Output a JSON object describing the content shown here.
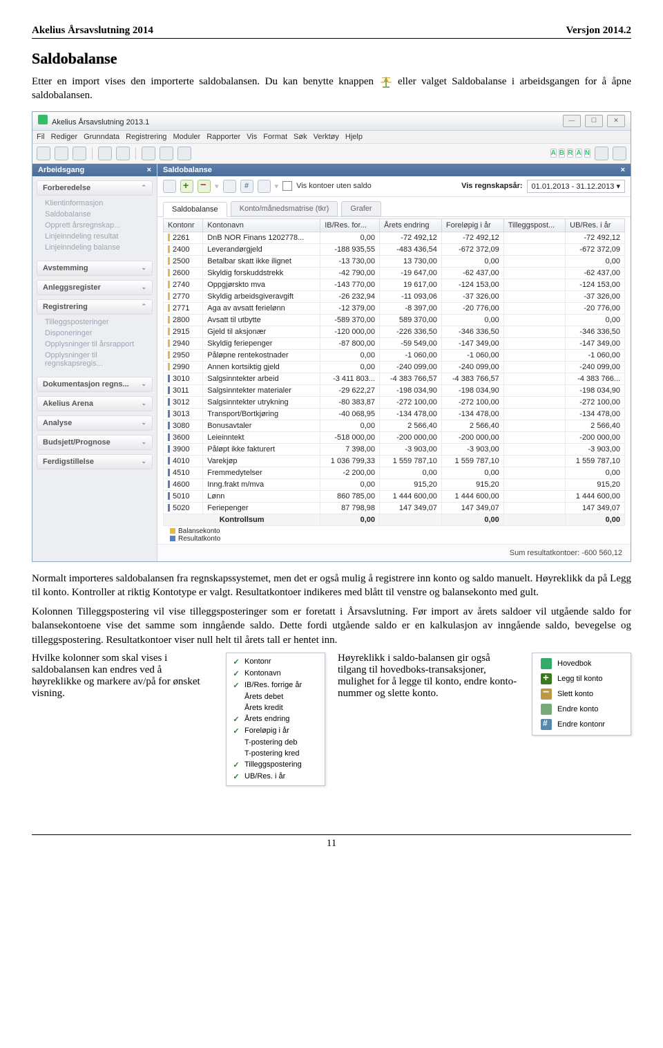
{
  "doc": {
    "header_left": "Akelius Årsavslutning 2014",
    "header_right": "Versjon 2014.2",
    "title": "Saldobalanse",
    "p1_a": "Etter en import vises den importerte saldobalansen. Du kan benytte knappen ",
    "p1_b": " eller valget Saldobalanse i arbeidsgangen for å åpne saldobalansen.",
    "p2": "Normalt importeres saldobalansen fra regnskapssystemet, men det er også mulig å registrere inn konto og saldo manuelt. Høyreklikk da på Legg til konto. Kontroller at riktig Kontotype er valgt. Resultatkontoer indikeres med blått til venstre og balansekonto med gult.",
    "p3": "Kolonnen Tilleggspostering vil vise tilleggsposteringer som er foretatt i Årsavslutning. Før import av årets saldoer vil utgående saldo for balansekontoene vise det samme som inngående saldo. Dette fordi utgående saldo er en kalkulasjon av inngående saldo, bevegelse og tilleggspostering. Resultatkontoer viser null helt til årets tall er hentet inn.",
    "left_col": "Hvilke kolonner som skal vises i saldobalansen kan endres ved å høyreklikke og markere av/på for ønsket visning.",
    "right_col": "Høyreklikk i saldo-balansen gir også tilgang til hovedboks-transaksjoner, mulighet for å legge til konto, endre konto-nummer og slette konto.",
    "page_number": "11"
  },
  "app": {
    "title": "Akelius Årsavslutning 2013.1",
    "menu": [
      "Fil",
      "Rediger",
      "Grunndata",
      "Registrering",
      "Moduler",
      "Rapporter",
      "Vis",
      "Format",
      "Søk",
      "Verktøy",
      "Hjelp"
    ],
    "sidebar_title": "Arbeidsgang",
    "groups": {
      "g1": "Forberedelse",
      "g1_items": [
        "Klientinformasjon",
        "Saldobalanse",
        "Opprett årsregnskap...",
        "Linjeinndeling resultat",
        "Linjeinndeling balanse"
      ],
      "g2": "Avstemming",
      "g3": "Anleggsregister",
      "g4": "Registrering",
      "g4_items": [
        "Tilleggsposteringer",
        "Disponeringer",
        "Opplysninger til årsrapport",
        "Opplysninger til regnskapsregis..."
      ],
      "g5": "Dokumentasjon regns...",
      "g6": "Akelius Arena",
      "g7": "Analyse",
      "g8": "Budsjett/Prognose",
      "g9": "Ferdigstillelse"
    },
    "content_title": "Saldobalanse",
    "show_no_saldo": "Vis kontoer uten saldo",
    "year_label": "Vis regnskapsår:",
    "year_value": "01.01.2013 - 31.12.2013",
    "tabs": [
      "Saldobalanse",
      "Konto/månedsmatrise (tkr)",
      "Grafer"
    ],
    "columns": [
      "Kontonr",
      "Kontonavn",
      "IB/Res. for...",
      "Årets endring",
      "Foreløpig i år",
      "Tilleggspost...",
      "UB/Res. i år"
    ],
    "legend_b": "Balansekonto",
    "legend_r": "Resultatkonto",
    "kontrollsum": "Kontrollsum",
    "ks_zero": "0,00",
    "sumline": "Sum resultatkontoer: -600 560,12"
  },
  "rows": [
    {
      "m": "y",
      "nr": "2261",
      "navn": "DnB NOR Finans 1202778...",
      "ib": "0,00",
      "end": "-72 492,12",
      "for": "-72 492,12",
      "til": "",
      "ub": "-72 492,12"
    },
    {
      "m": "y",
      "nr": "2400",
      "navn": "Leverandørgjeld",
      "ib": "-188 935,55",
      "end": "-483 436,54",
      "for": "-672 372,09",
      "til": "",
      "ub": "-672 372,09"
    },
    {
      "m": "y",
      "nr": "2500",
      "navn": "Betalbar skatt ikke ilignet",
      "ib": "-13 730,00",
      "end": "13 730,00",
      "for": "0,00",
      "til": "",
      "ub": "0,00"
    },
    {
      "m": "y",
      "nr": "2600",
      "navn": "Skyldig forskuddstrekk",
      "ib": "-42 790,00",
      "end": "-19 647,00",
      "for": "-62 437,00",
      "til": "",
      "ub": "-62 437,00"
    },
    {
      "m": "y",
      "nr": "2740",
      "navn": "Oppgjørskto mva",
      "ib": "-143 770,00",
      "end": "19 617,00",
      "for": "-124 153,00",
      "til": "",
      "ub": "-124 153,00"
    },
    {
      "m": "y",
      "nr": "2770",
      "navn": "Skyldig arbeidsgiveravgift",
      "ib": "-26 232,94",
      "end": "-11 093,06",
      "for": "-37 326,00",
      "til": "",
      "ub": "-37 326,00"
    },
    {
      "m": "y",
      "nr": "2771",
      "navn": "Aga av avsatt ferielønn",
      "ib": "-12 379,00",
      "end": "-8 397,00",
      "for": "-20 776,00",
      "til": "",
      "ub": "-20 776,00"
    },
    {
      "m": "y",
      "nr": "2800",
      "navn": "Avsatt til utbytte",
      "ib": "-589 370,00",
      "end": "589 370,00",
      "for": "0,00",
      "til": "",
      "ub": "0,00"
    },
    {
      "m": "y",
      "nr": "2915",
      "navn": "Gjeld til aksjonær",
      "ib": "-120 000,00",
      "end": "-226 336,50",
      "for": "-346 336,50",
      "til": "",
      "ub": "-346 336,50"
    },
    {
      "m": "y",
      "nr": "2940",
      "navn": "Skyldig feriepenger",
      "ib": "-87 800,00",
      "end": "-59 549,00",
      "for": "-147 349,00",
      "til": "",
      "ub": "-147 349,00"
    },
    {
      "m": "y",
      "nr": "2950",
      "navn": "Påløpne rentekostnader",
      "ib": "0,00",
      "end": "-1 060,00",
      "for": "-1 060,00",
      "til": "",
      "ub": "-1 060,00"
    },
    {
      "m": "y",
      "nr": "2990",
      "navn": "Annen kortsiktig gjeld",
      "ib": "0,00",
      "end": "-240 099,00",
      "for": "-240 099,00",
      "til": "",
      "ub": "-240 099,00"
    },
    {
      "m": "b",
      "nr": "3010",
      "navn": "Salgsinntekter arbeid",
      "ib": "-3 411 803...",
      "end": "-4 383 766,57",
      "for": "-4 383 766,57",
      "til": "",
      "ub": "-4 383 766..."
    },
    {
      "m": "b",
      "nr": "3011",
      "navn": "Salgsinntekter materialer",
      "ib": "-29 622,27",
      "end": "-198 034,90",
      "for": "-198 034,90",
      "til": "",
      "ub": "-198 034,90"
    },
    {
      "m": "b",
      "nr": "3012",
      "navn": "Salgsinntekter utrykning",
      "ib": "-80 383,87",
      "end": "-272 100,00",
      "for": "-272 100,00",
      "til": "",
      "ub": "-272 100,00"
    },
    {
      "m": "b",
      "nr": "3013",
      "navn": "Transport/Bortkjøring",
      "ib": "-40 068,95",
      "end": "-134 478,00",
      "for": "-134 478,00",
      "til": "",
      "ub": "-134 478,00"
    },
    {
      "m": "b",
      "nr": "3080",
      "navn": "Bonusavtaler",
      "ib": "0,00",
      "end": "2 566,40",
      "for": "2 566,40",
      "til": "",
      "ub": "2 566,40"
    },
    {
      "m": "b",
      "nr": "3600",
      "navn": "Leieinntekt",
      "ib": "-518 000,00",
      "end": "-200 000,00",
      "for": "-200 000,00",
      "til": "",
      "ub": "-200 000,00"
    },
    {
      "m": "b",
      "nr": "3900",
      "navn": "Påløpt ikke fakturert",
      "ib": "7 398,00",
      "end": "-3 903,00",
      "for": "-3 903,00",
      "til": "",
      "ub": "-3 903,00"
    },
    {
      "m": "b",
      "nr": "4010",
      "navn": "Varekjøp",
      "ib": "1 036 799,33",
      "end": "1 559 787,10",
      "for": "1 559 787,10",
      "til": "",
      "ub": "1 559 787,10"
    },
    {
      "m": "b",
      "nr": "4510",
      "navn": "Fremmedytelser",
      "ib": "-2 200,00",
      "end": "0,00",
      "for": "0,00",
      "til": "",
      "ub": "0,00"
    },
    {
      "m": "b",
      "nr": "4600",
      "navn": "Inng.frakt m/mva",
      "ib": "0,00",
      "end": "915,20",
      "for": "915,20",
      "til": "",
      "ub": "915,20"
    },
    {
      "m": "b",
      "nr": "5010",
      "navn": "Lønn",
      "ib": "860 785,00",
      "end": "1 444 600,00",
      "for": "1 444 600,00",
      "til": "",
      "ub": "1 444 600,00"
    },
    {
      "m": "b",
      "nr": "5020",
      "navn": "Feriepenger",
      "ib": "87 798,98",
      "end": "147 349,07",
      "for": "147 349,07",
      "til": "",
      "ub": "147 349,07"
    }
  ],
  "popup_cols": [
    {
      "c": true,
      "t": "Kontonr"
    },
    {
      "c": true,
      "t": "Kontonavn"
    },
    {
      "c": true,
      "t": "IB/Res. forrige år"
    },
    {
      "c": false,
      "t": "Årets debet"
    },
    {
      "c": false,
      "t": "Årets kredit"
    },
    {
      "c": true,
      "t": "Årets endring"
    },
    {
      "c": true,
      "t": "Foreløpig i år"
    },
    {
      "c": false,
      "t": "T-postering deb"
    },
    {
      "c": false,
      "t": "T-postering kred"
    },
    {
      "c": true,
      "t": "Tilleggspostering"
    },
    {
      "c": true,
      "t": "UB/Res. i år"
    }
  ],
  "popup_ctx": [
    {
      "i": "book",
      "t": "Hovedbok"
    },
    {
      "i": "plus",
      "t": "Legg til konto"
    },
    {
      "i": "minus",
      "t": "Slett konto"
    },
    {
      "i": "edit",
      "t": "Endre konto"
    },
    {
      "i": "hash",
      "t": "Endre kontonr"
    }
  ],
  "tb_letters": [
    "A",
    "B",
    "R",
    "A",
    "N"
  ]
}
